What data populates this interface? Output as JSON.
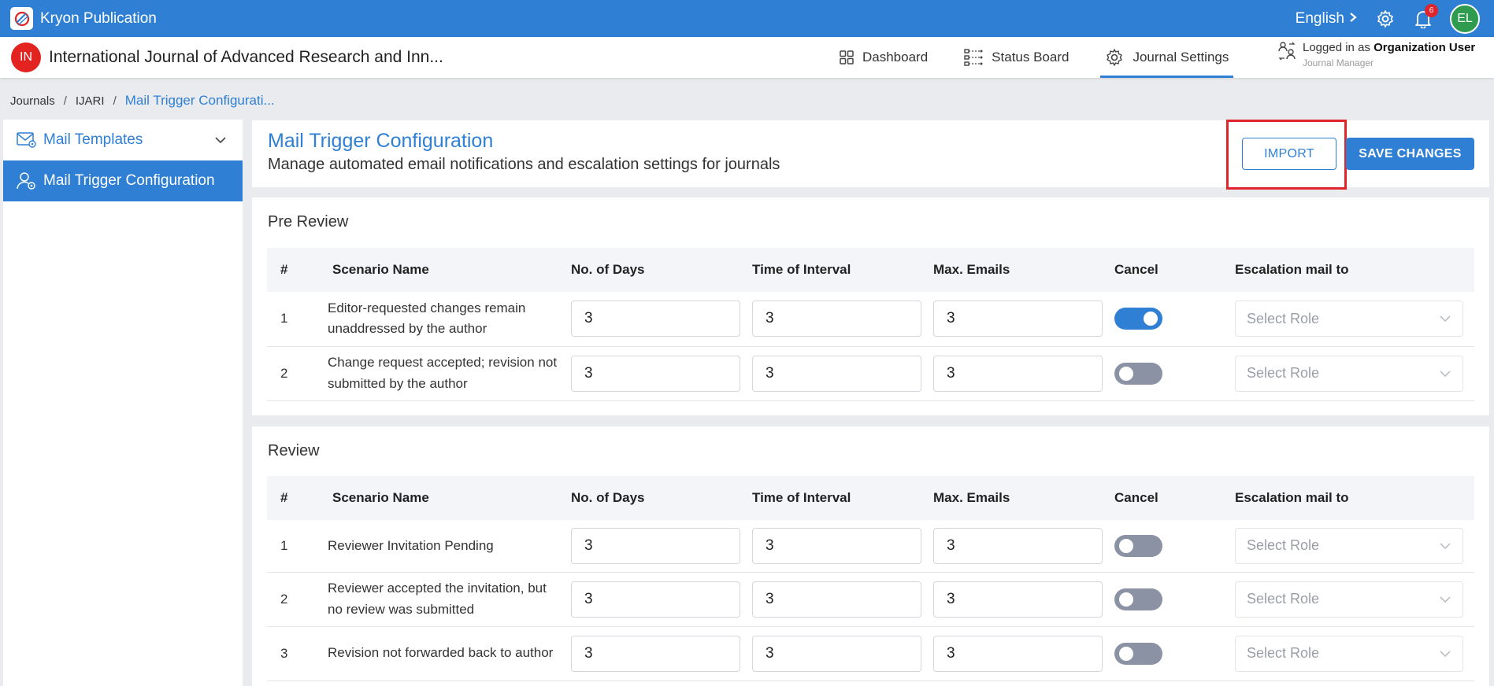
{
  "app": {
    "name": "Kryon Publication",
    "language": "English",
    "notification_count": "6",
    "avatar_initials": "EL"
  },
  "journal": {
    "initials": "IN",
    "title": "International Journal of Advanced Research and Inn..."
  },
  "nav": {
    "dashboard": "Dashboard",
    "status_board": "Status Board",
    "journal_settings": "Journal Settings"
  },
  "user": {
    "logged_in_prefix": "Logged in as",
    "name": "Organization User",
    "role": "Journal Manager"
  },
  "breadcrumb": {
    "items": [
      "Journals",
      "IJARI",
      "Mail Trigger Configurati..."
    ],
    "separator": "/"
  },
  "sidebar": {
    "items": [
      {
        "label": "Mail Templates"
      },
      {
        "label": "Mail Trigger Configuration"
      }
    ]
  },
  "header": {
    "title": "Mail Trigger Configuration",
    "subtitle": "Manage automated email notifications and escalation settings for journals",
    "import_label": "IMPORT",
    "save_label": "SAVE CHANGES"
  },
  "columns": {
    "num": "#",
    "scenario": "Scenario Name",
    "days": "No. of Days",
    "interval": "Time of Interval",
    "max": "Max. Emails",
    "cancel": "Cancel",
    "escalation": "Escalation mail to"
  },
  "pre_review": {
    "title": "Pre Review",
    "rows": [
      {
        "num": "1",
        "name": "Editor-requested changes remain unaddressed by the author",
        "days": "3",
        "interval": "3",
        "max": "3",
        "cancel": true,
        "escalation": "Select Role"
      },
      {
        "num": "2",
        "name": "Change request accepted; revision not submitted by the author",
        "days": "3",
        "interval": "3",
        "max": "3",
        "cancel": false,
        "escalation": "Select Role"
      }
    ]
  },
  "review": {
    "title": "Review",
    "rows": [
      {
        "num": "1",
        "name": "Reviewer Invitation Pending",
        "days": "3",
        "interval": "3",
        "max": "3",
        "cancel": false,
        "escalation": "Select Role"
      },
      {
        "num": "2",
        "name": "Reviewer accepted the invitation, but no review was submitted",
        "days": "3",
        "interval": "3",
        "max": "3",
        "cancel": false,
        "escalation": "Select Role"
      },
      {
        "num": "3",
        "name": "Revision not forwarded back to author",
        "days": "3",
        "interval": "3",
        "max": "3",
        "cancel": false,
        "escalation": "Select Role"
      }
    ]
  },
  "colors": {
    "primary": "#2f7fd4",
    "highlight": "#e0242b",
    "toggle_off": "#8b92a3"
  }
}
